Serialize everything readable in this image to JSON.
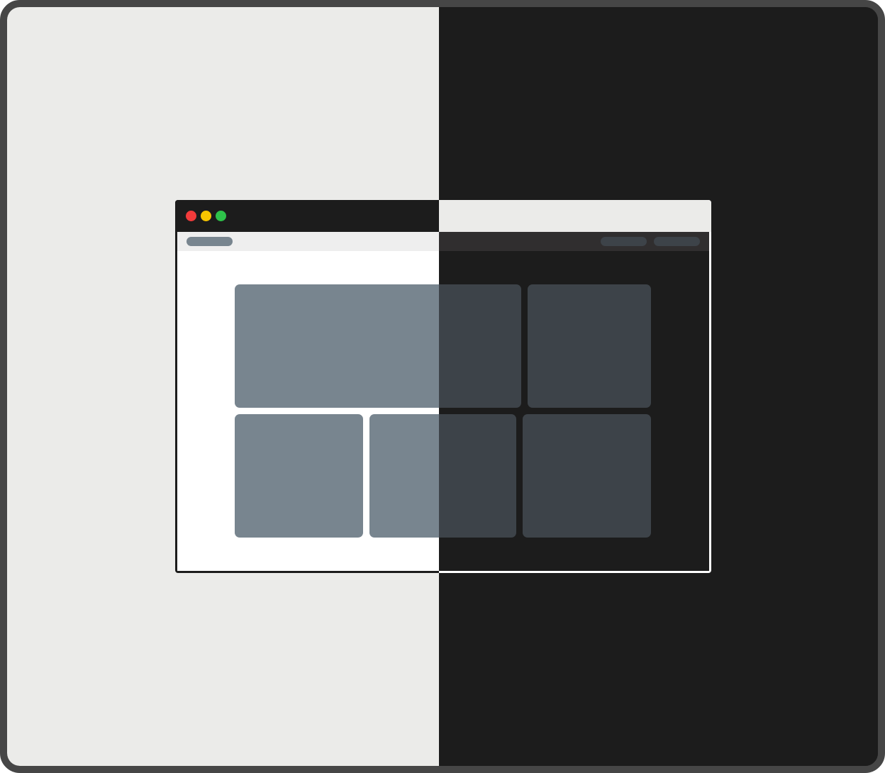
{
  "theme_comparison": {
    "left_theme": "light",
    "right_theme": "dark",
    "colors": {
      "light_background": "#ebebe9",
      "dark_background": "#1c1c1c",
      "frame_border": "#464646",
      "light_placeholder": "#78858f",
      "dark_placeholder": "#3d4349",
      "traffic_red": "#f23b3b",
      "traffic_yellow": "#f7c500",
      "traffic_green": "#2ec24a"
    }
  },
  "window": {
    "traffic_lights": [
      "close-dot",
      "minimize-dot",
      "maximize-dot"
    ],
    "toolbar": {
      "left_pills": 1,
      "right_pills": 2
    },
    "tiles": 5
  }
}
